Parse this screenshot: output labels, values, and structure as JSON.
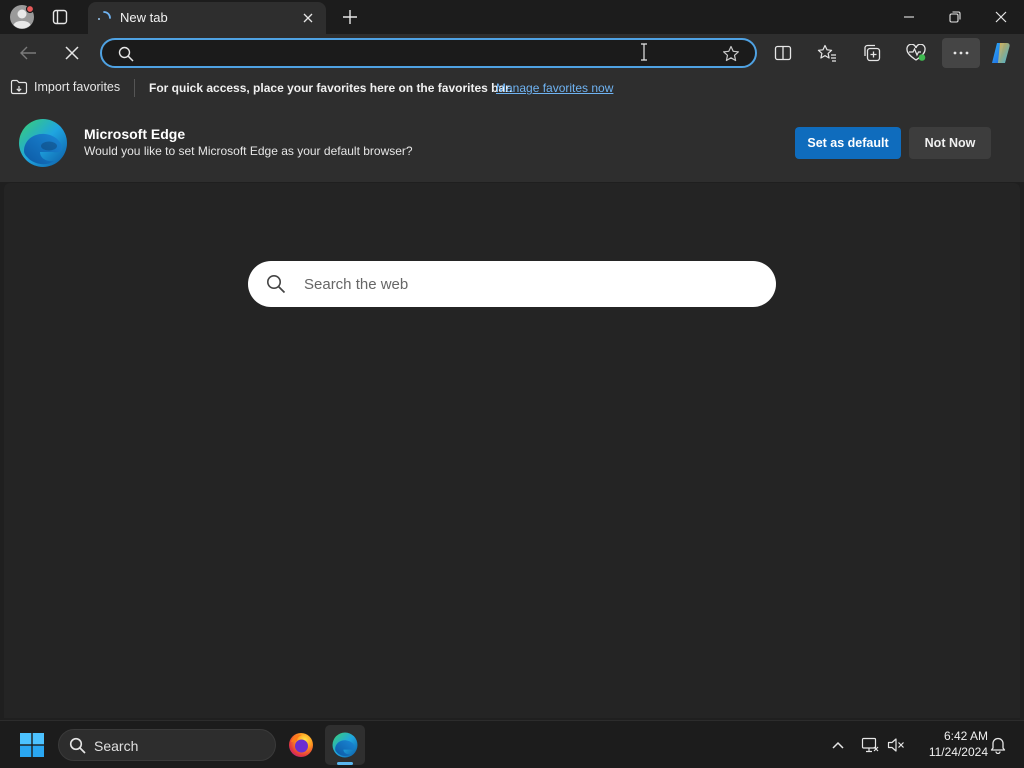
{
  "tab": {
    "title": "New tab"
  },
  "address_bar": {
    "value": "",
    "placeholder": ""
  },
  "favorites_bar": {
    "import_label": "Import favorites",
    "message": "For quick access, place your favorites here on the favorites bar.",
    "link_label": "Manage favorites now"
  },
  "infobar": {
    "title": "Microsoft Edge",
    "text": "Would you like to set Microsoft Edge as your default browser?",
    "primary_button": "Set as default",
    "secondary_button": "Not Now"
  },
  "web_search": {
    "placeholder": "Search the web"
  },
  "taskbar": {
    "search_label": "Search",
    "time": "6:42 AM",
    "date": "11/24/2024"
  },
  "icons": {
    "profile": "profile-icon",
    "tab_actions": "tab-actions-icon",
    "edge": "edge-logo-icon",
    "firefox": "firefox-icon",
    "windows": "windows-start-icon"
  },
  "colors": {
    "accent": "#0f6cbd",
    "address_focus": "#4fa2e3",
    "link": "#6fb3f2",
    "page_bg": "#242424",
    "chrome_bg": "#2e2e2e"
  }
}
